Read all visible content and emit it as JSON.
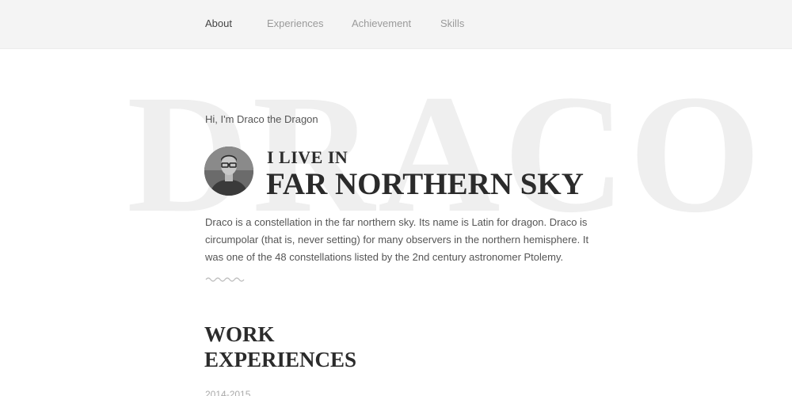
{
  "nav": {
    "items": [
      {
        "label": "About",
        "active": true
      },
      {
        "label": "Experiences",
        "active": false
      },
      {
        "label": "Achievement",
        "active": false
      },
      {
        "label": "Skills",
        "active": false
      }
    ]
  },
  "hero": {
    "background_word": "DRACO",
    "greeting": "Hi, I'm Draco the Dragon",
    "heading_small": "I LIVE IN",
    "heading_large": "FAR NORTHERN SKY",
    "avatar_icon": "person-avatar-icon",
    "bio": "Draco is a constellation in the far northern sky. Its name is Latin for dragon. Draco is circumpolar (that is, never setting) for many observers in the northern hemisphere. It was one of the 48 constellations listed by the 2nd century astronomer Ptolemy.",
    "divider_icon": "squiggle-divider-icon"
  },
  "work": {
    "title_line1": "WORK",
    "title_line2": "EXPERIENCES",
    "first_period": "2014-2015"
  },
  "colors": {
    "nav_bg": "#f4f4f4",
    "nav_active": "#444444",
    "nav_inactive": "#9a9a9a",
    "heading": "#2b2b2b",
    "watermark": "#efefef"
  }
}
